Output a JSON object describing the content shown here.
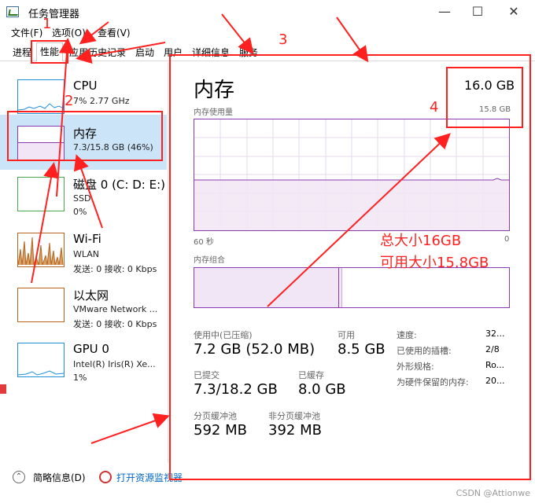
{
  "window": {
    "title": "任务管理器",
    "minimize": "—",
    "maximize": "☐",
    "close": "✕"
  },
  "menu": [
    "文件(F)",
    "选项(O)",
    "查看(V)"
  ],
  "tabs": [
    "进程",
    "性能",
    "应用历史记录",
    "启动",
    "用户",
    "详细信息",
    "服务"
  ],
  "sidebar": [
    {
      "title": "CPU",
      "sub": "7% 2.77 GHz",
      "sub2": ""
    },
    {
      "title": "内存",
      "sub": "7.3/15.8 GB (46%)",
      "sub2": ""
    },
    {
      "title": "磁盘 0 (C: D: E:)",
      "sub": "SSD",
      "sub2": "0%"
    },
    {
      "title": "Wi-Fi",
      "sub": "WLAN",
      "sub2": "发送: 0 接收: 0 Kbps"
    },
    {
      "title": "以太网",
      "sub": "VMware Network ...",
      "sub2": "发送: 0 接收: 0 Kbps"
    },
    {
      "title": "GPU 0",
      "sub": "Intel(R) Iris(R) Xe...",
      "sub2": "1%"
    }
  ],
  "memory": {
    "heading": "内存",
    "total": "16.0 GB",
    "usable": "15.8 GB",
    "usage_label": "内存使用量",
    "time_left": "60 秒",
    "time_right": "0",
    "composition_label": "内存组合",
    "in_use_label": "使用中(已压缩)",
    "in_use_value": "7.2 GB (52.0 MB)",
    "available_label": "可用",
    "available_value": "8.5 GB",
    "committed_label": "已提交",
    "committed_value": "7.3/18.2 GB",
    "cached_label": "已缓存",
    "cached_value": "8.0 GB",
    "paged_label": "分页缓冲池",
    "paged_value": "592 MB",
    "nonpaged_label": "非分页缓冲池",
    "nonpaged_value": "392 MB",
    "details": [
      {
        "k": "速度:",
        "v": "32..."
      },
      {
        "k": "已使用的插槽:",
        "v": "2/8"
      },
      {
        "k": "外形规格:",
        "v": "Ro..."
      },
      {
        "k": "为硬件保留的内存:",
        "v": "20..."
      }
    ]
  },
  "footer": {
    "brief": "简略信息(D)",
    "monitor": "打开资源监视器"
  },
  "annotations": {
    "n1": "1",
    "n2": "2",
    "n3": "3",
    "n4": "4",
    "note_total": "总大小16GB",
    "note_usable": "可用大小15.8GB"
  },
  "watermark": "CSDN @Attionwe",
  "colors": {
    "memory_purple": "#8a3bb0",
    "cpu_blue": "#1f8fd8",
    "disk_green": "#4ca64c",
    "wifi_orange": "#b5651d",
    "annotation_red": "#ff2020"
  }
}
